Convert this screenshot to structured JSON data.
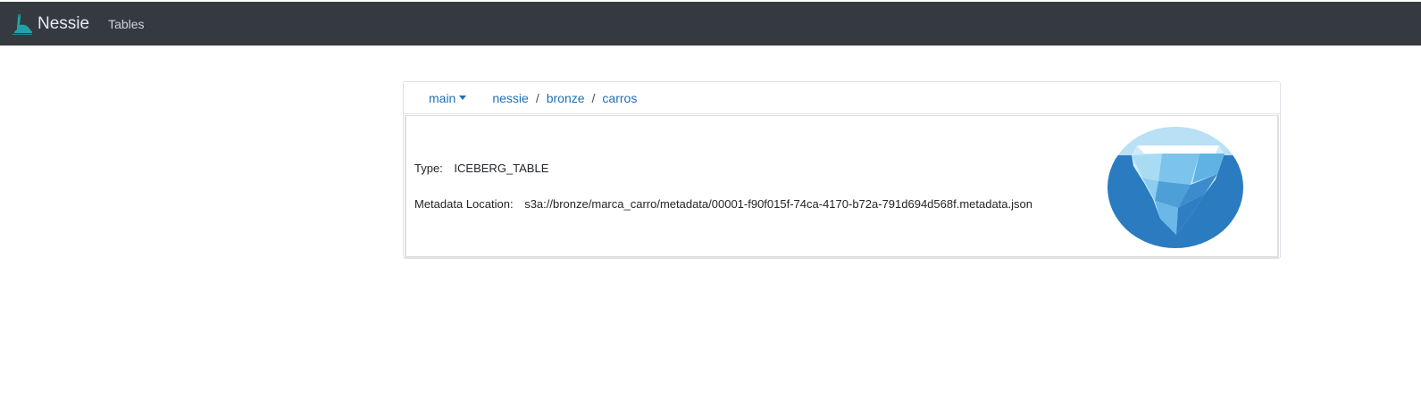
{
  "navbar": {
    "brand": "Nessie",
    "links": [
      "Tables"
    ]
  },
  "table_card": {
    "branch": "main",
    "breadcrumb": [
      "nessie",
      "bronze",
      "carros"
    ],
    "separator": "/",
    "type_label": "Type:",
    "type_value": "ICEBERG_TABLE",
    "metadata_label": "Metadata Location:",
    "metadata_value": "s3a://bronze/marca_carro/metadata/00001-f90f015f-74ca-4170-b72a-791d694d568f.metadata.json",
    "logo_icon": "iceberg-icon"
  },
  "colors": {
    "navbar_bg": "#343a40",
    "link": "#1f6fb5",
    "iceberg_dark": "#2a7bc0",
    "iceberg_light": "#b9e0f4"
  }
}
